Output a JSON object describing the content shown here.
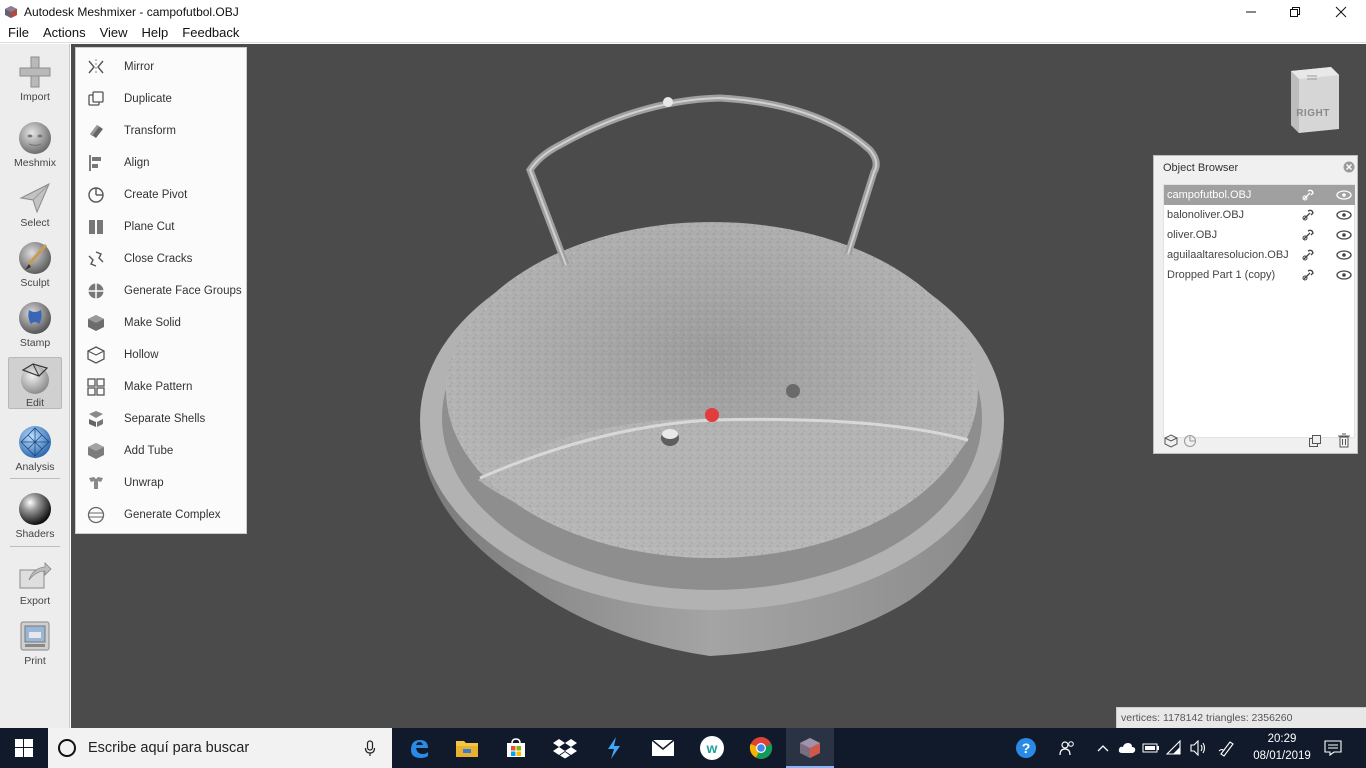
{
  "window": {
    "title": "Autodesk Meshmixer - campofutbol.OBJ"
  },
  "menubar": {
    "items": [
      "File",
      "Actions",
      "View",
      "Help",
      "Feedback"
    ]
  },
  "toolbar": {
    "tools": [
      {
        "label": "Import",
        "icon": "import-icon"
      },
      {
        "label": "Meshmix",
        "icon": "meshmix-icon"
      },
      {
        "label": "Select",
        "icon": "select-icon"
      },
      {
        "label": "Sculpt",
        "icon": "sculpt-icon"
      },
      {
        "label": "Stamp",
        "icon": "stamp-icon"
      },
      {
        "label": "Edit",
        "icon": "edit-icon",
        "active": true
      },
      {
        "label": "Analysis",
        "icon": "analysis-icon"
      },
      {
        "label": "Shaders",
        "icon": "shaders-icon"
      },
      {
        "label": "Export",
        "icon": "export-icon"
      },
      {
        "label": "Print",
        "icon": "print-icon"
      }
    ]
  },
  "edit_menu": {
    "items": [
      {
        "label": "Mirror",
        "icon": "mirror-icon"
      },
      {
        "label": "Duplicate",
        "icon": "duplicate-icon"
      },
      {
        "label": "Transform",
        "icon": "transform-icon"
      },
      {
        "label": "Align",
        "icon": "align-icon"
      },
      {
        "label": "Create Pivot",
        "icon": "create-pivot-icon"
      },
      {
        "label": "Plane Cut",
        "icon": "plane-cut-icon"
      },
      {
        "label": "Close Cracks",
        "icon": "close-cracks-icon"
      },
      {
        "label": "Generate Face Groups",
        "icon": "face-groups-icon"
      },
      {
        "label": "Make Solid",
        "icon": "make-solid-icon"
      },
      {
        "label": "Hollow",
        "icon": "hollow-icon"
      },
      {
        "label": "Make Pattern",
        "icon": "make-pattern-icon"
      },
      {
        "label": "Separate Shells",
        "icon": "separate-shells-icon"
      },
      {
        "label": "Add Tube",
        "icon": "add-tube-icon"
      },
      {
        "label": "Unwrap",
        "icon": "unwrap-icon"
      },
      {
        "label": "Generate Complex",
        "icon": "generate-complex-icon"
      }
    ]
  },
  "viewcube": {
    "face": "RIGHT"
  },
  "object_browser": {
    "title": "Object Browser",
    "objects": [
      {
        "name": "campofutbol.OBJ",
        "selected": true
      },
      {
        "name": "balonoliver.OBJ",
        "selected": false
      },
      {
        "name": "oliver.OBJ",
        "selected": false
      },
      {
        "name": "aguilaaltaresolucion.OBJ",
        "selected": false
      },
      {
        "name": "Dropped Part 1 (copy)",
        "selected": false
      }
    ]
  },
  "stats": {
    "text": "vertices: 1178142 triangles: 2356260"
  },
  "taskbar": {
    "search_placeholder": "Escribe aquí para buscar",
    "apps": [
      "edge-icon",
      "file-explorer-icon",
      "store-icon",
      "dropbox-icon",
      "app-icon",
      "mail-icon",
      "w-app-icon",
      "chrome-icon",
      "meshmixer-icon"
    ],
    "clock_time": "20:29",
    "clock_date": "08/01/2019"
  },
  "colors": {
    "viewport_bg": "#4b4b4b",
    "taskbar_bg": "#101a2b",
    "selected_row": "#a0a0a0",
    "pivot_red": "#e23c3c"
  }
}
